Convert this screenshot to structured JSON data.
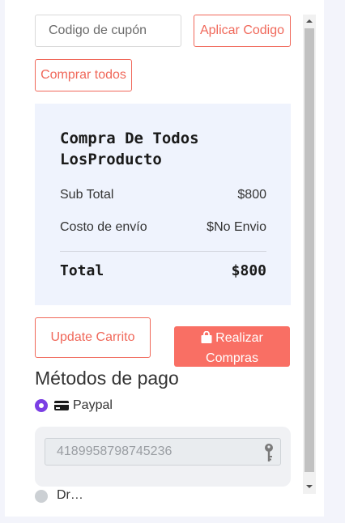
{
  "coupon": {
    "placeholder": "Codigo de cupón",
    "apply_label": "Aplicar Codigo",
    "buy_all_label": "Comprar todos"
  },
  "summary": {
    "title": "Compra De Todos LosProducto",
    "subtotal_label": "Sub Total",
    "subtotal_value": "$800",
    "shipping_label": "Costo de envío",
    "shipping_value": "$No Envio",
    "total_label": "Total",
    "total_value": "$800"
  },
  "actions": {
    "update_label": "Update Carrito",
    "checkout_label": "Realizar Compras"
  },
  "payment": {
    "title": "Métodos de pago",
    "paypal_label": "Paypal",
    "card_number": "4189958798745236",
    "next_method_label": "Dr…"
  },
  "colors": {
    "accent": "#f0685a",
    "checkout_bg": "#f96f64",
    "radio_selected": "#7b3fe4",
    "summary_bg": "#eff3fd"
  },
  "icons": {
    "checkout": "shopping-bag-icon",
    "paypal": "credit-card-icon",
    "card_field": "key-icon"
  }
}
